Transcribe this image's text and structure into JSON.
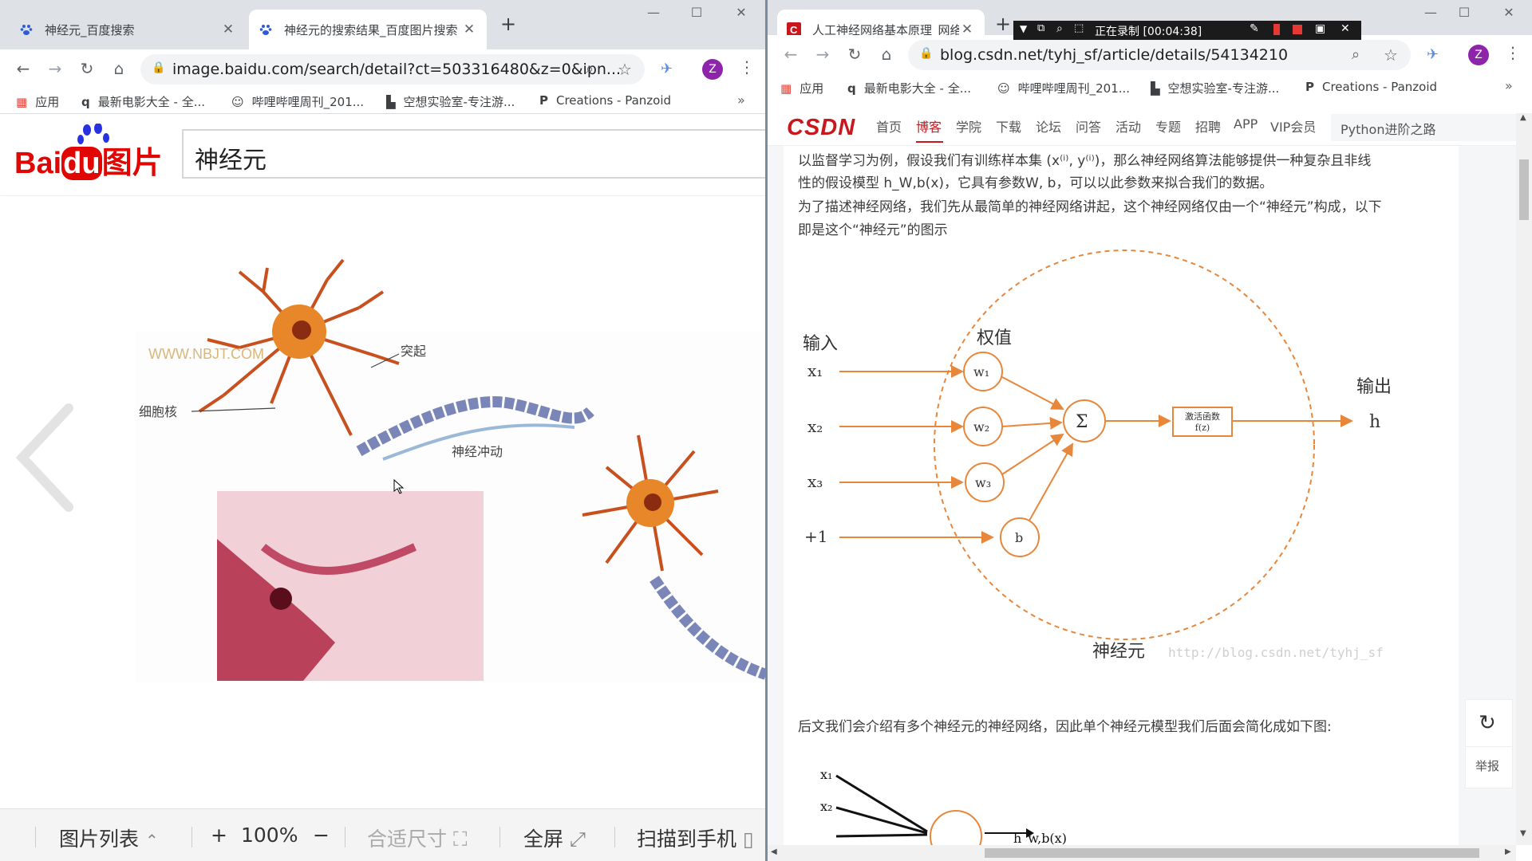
{
  "left_window": {
    "tabs": [
      {
        "title": "神经元_百度搜索",
        "active": false
      },
      {
        "title": "神经元的搜索结果_百度图片搜索",
        "active": true
      }
    ],
    "url": "image.baidu.com/search/detail?ct=503316480&z=0&ipn...",
    "avatar_letter": "Z",
    "bookmarks": [
      "应用",
      "最新电影大全 - 全...",
      "哔哩哔哩周刊_201...",
      "空想实验室-专注游...",
      "Creations - Panzoid"
    ],
    "logo": {
      "bai": "Bai",
      "du": "du",
      "tupian": "图片"
    },
    "search_value": "神经元",
    "image_labels": {
      "watermark": "WWW.NBJT.COM",
      "nucleus": "细胞核",
      "process": "突起",
      "impulse": "神经冲动"
    },
    "bottom_bar": {
      "list": "图片列表",
      "zoom_in": "+",
      "zoom": "100%",
      "zoom_out": "−",
      "fit": "合适尺寸",
      "fullscreen": "全屏",
      "scan": "扫描到手机"
    }
  },
  "right_window": {
    "tabs": [
      {
        "title": "人工神经网络基本原理_网络_Ste",
        "active": true
      }
    ],
    "url": "blog.csdn.net/tyhj_sf/article/details/54134210",
    "avatar_letter": "Z",
    "recording": "正在录制 [00:04:38]",
    "bookmarks": [
      "应用",
      "最新电影大全 - 全...",
      "哔哩哔哩周刊_201...",
      "空想实验室-专注游...",
      "Creations - Panzoid"
    ],
    "csdn": {
      "logo": "CSDN",
      "nav": [
        "首页",
        "博客",
        "学院",
        "下载",
        "论坛",
        "问答",
        "活动",
        "专题",
        "招聘",
        "APP",
        "VIP会员"
      ],
      "active_nav": "博客",
      "search_value": "Python进阶之路"
    },
    "article": {
      "p1_line1": "以监督学习为例，假设我们有训练样本集 (x⁽ⁱ⁾, y⁽ⁱ⁾)，那么神经网络算法能够提供一种复杂且非线",
      "p1_line2": "性的假设模型 h_W,b(x)，它具有参数W, b，可以以此参数来拟合我们的数据。",
      "p2_line1": "为了描述神经网络，我们先从最简单的神经网络讲起，这个神经网络仅由一个“神经元”构成，以下",
      "p2_line2": "即是这个“神经元”的图示",
      "p3": "后文我们会介绍有多个神经元的神经网络，因此单个神经元模型我们后面会简化成如下图:"
    },
    "diagram": {
      "input_label": "输入",
      "weight_label": "权值",
      "output_label": "输出",
      "neuron_label": "神经元",
      "inputs": [
        "x₁",
        "x₂",
        "x₃",
        "+1"
      ],
      "weights": [
        "w₁",
        "w₂",
        "w₃",
        "b"
      ],
      "sum": "Σ",
      "activation_line1": "激活函数",
      "activation_line2": "f(z)",
      "output": "h",
      "watermark": "http://blog.csdn.net/tyhj_sf"
    },
    "diagram2": {
      "inputs": [
        "x₁",
        "x₂"
      ],
      "output": "h_w,b(x)"
    },
    "float_tool": {
      "report": "举报"
    }
  }
}
